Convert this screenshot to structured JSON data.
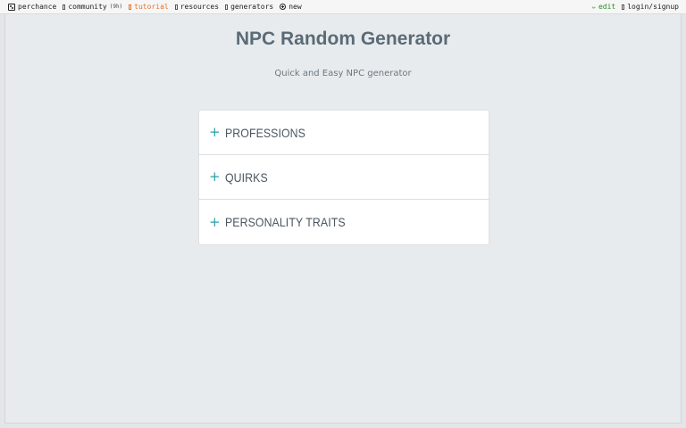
{
  "topbar": {
    "left": [
      {
        "label": "perchance",
        "icon": "dice-icon"
      },
      {
        "label": "community",
        "badge": "(9h)",
        "icon": "chat-icon"
      },
      {
        "label": "tutorial",
        "icon": "book-icon",
        "color": "#e0742c"
      },
      {
        "label": "resources",
        "icon": "folder-icon"
      },
      {
        "label": "generators",
        "icon": "list-icon"
      },
      {
        "label": "new",
        "icon": "plus-circle-icon"
      }
    ],
    "right": [
      {
        "label": "edit",
        "icon": "pencil-icon",
        "color": "#2a8a2a"
      },
      {
        "label": "login/signup",
        "icon": "user-icon"
      }
    ]
  },
  "main": {
    "title": "NPC Random Generator",
    "subtitle": "Quick and Easy NPC generator",
    "accordion": [
      {
        "icon": "plus-icon",
        "label": "PROFESSIONS"
      },
      {
        "icon": "plus-icon",
        "label": "QUIRKS"
      },
      {
        "icon": "plus-icon",
        "label": "PERSONALITY TRAITS"
      }
    ]
  },
  "colors": {
    "accent": "#2aa0a8",
    "title": "#5a6b76",
    "background": "#e8ebee"
  }
}
